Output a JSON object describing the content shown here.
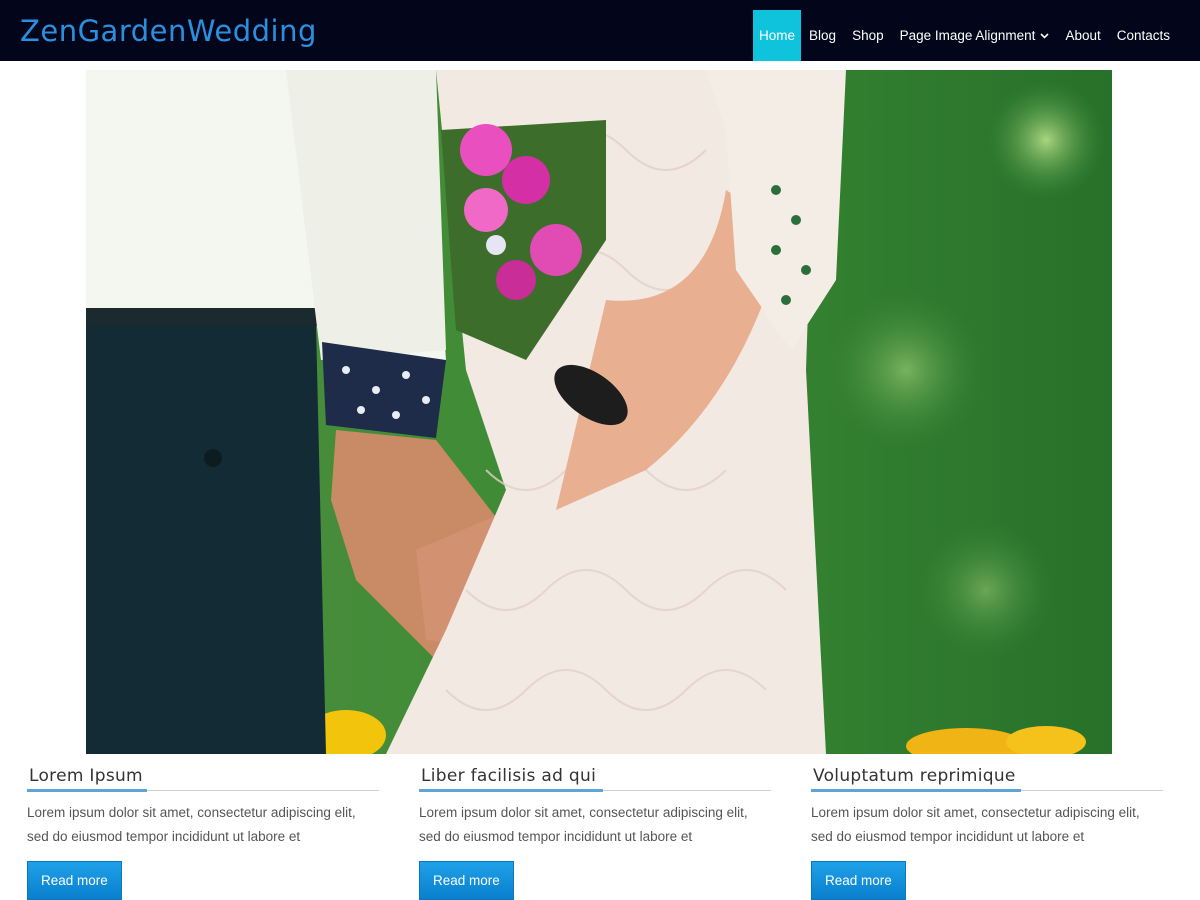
{
  "site": {
    "logo": "ZenGardenWedding"
  },
  "nav": {
    "items": [
      {
        "label": "Home",
        "active": true
      },
      {
        "label": "Blog"
      },
      {
        "label": "Shop"
      },
      {
        "label": "Page Image Alignment",
        "has_dropdown": true
      },
      {
        "label": "About"
      },
      {
        "label": "Contacts"
      }
    ]
  },
  "colors": {
    "header_bg": "#03051a",
    "logo": "#2b8fe0",
    "nav_active": "#0fc3dd",
    "button": "#1a91de",
    "title_underline": "#5da4d8"
  },
  "cards": [
    {
      "title": "Lorem Ipsum",
      "body": "Lorem ipsum dolor sit amet, consectetur adipiscing elit, sed do eiusmod tempor incididunt ut labore et",
      "button": "Read more"
    },
    {
      "title": "Liber facilisis ad qui",
      "body": "Lorem ipsum dolor sit amet, consectetur adipiscing elit, sed do eiusmod tempor incididunt ut labore et",
      "button": "Read more"
    },
    {
      "title": "Voluptatum reprimique",
      "body": "Lorem ipsum dolor sit amet, consectetur adipiscing elit, sed do eiusmod tempor incididunt ut labore et",
      "button": "Read more"
    }
  ]
}
